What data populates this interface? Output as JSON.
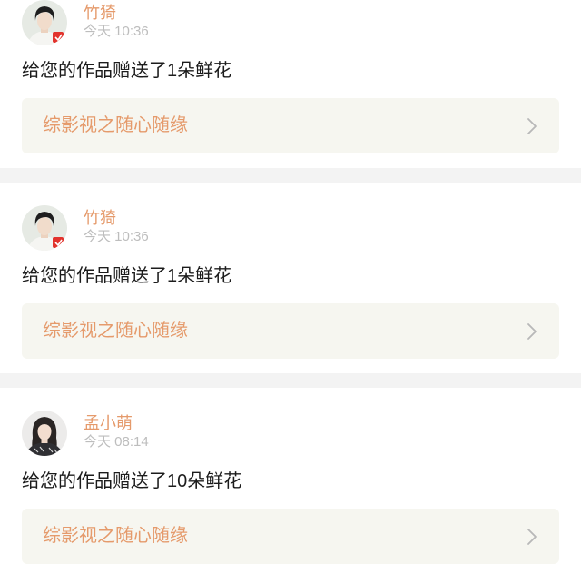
{
  "notifications": [
    {
      "user": "竹猗",
      "time": "今天 10:36",
      "message": "给您的作品赠送了1朵鲜花",
      "work_title": "综影视之随心随缘",
      "avatar_badge": true
    },
    {
      "user": "竹猗",
      "time": "今天 10:36",
      "message": "给您的作品赠送了1朵鲜花",
      "work_title": "综影视之随心随缘",
      "avatar_badge": true
    },
    {
      "user": "孟小萌",
      "time": "今天 08:14",
      "message": "给您的作品赠送了10朵鲜花",
      "work_title": "综影视之随心随缘",
      "avatar_badge": false
    }
  ],
  "colors": {
    "accent": "#e59a6b",
    "time_text": "#bdbdbd",
    "work_box_bg": "#f6f6f0",
    "separator": "#f3f3f3"
  },
  "icons": {
    "chevron": "chevron-right-icon",
    "badge": "avatar-badge-icon"
  }
}
